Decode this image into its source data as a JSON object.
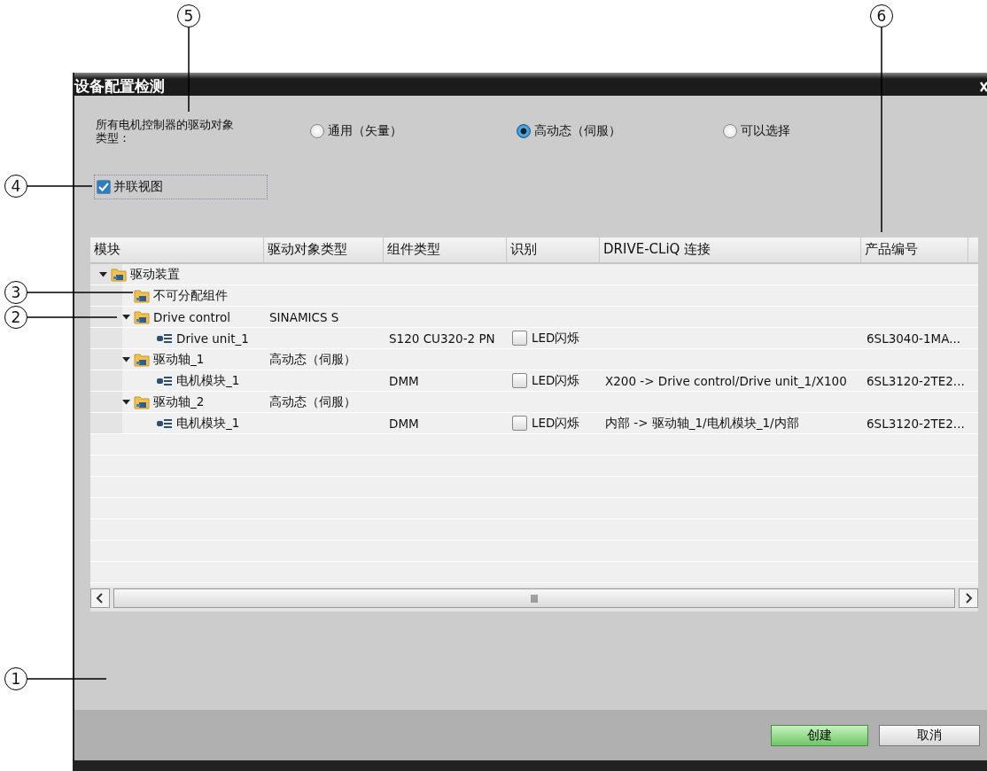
{
  "callouts": [
    {
      "number": "5"
    },
    {
      "number": "6"
    },
    {
      "number": "4"
    },
    {
      "number": "3"
    },
    {
      "number": "2"
    },
    {
      "number": "1"
    }
  ],
  "window": {
    "title": "设备配置检测"
  },
  "drive_type": {
    "label": "所有电机控制器的驱动对象类型：",
    "options": [
      {
        "label": "通用（矢量）",
        "selected": false
      },
      {
        "label": "高动态（伺服）",
        "selected": true
      },
      {
        "label": "可以选择",
        "selected": false
      }
    ]
  },
  "parallel_view": {
    "label": "并联视图",
    "checked": true
  },
  "table": {
    "columns": [
      "模块",
      "驱动对象类型",
      "组件类型",
      "识别",
      "DRIVE-CLiQ 连接",
      "产品编号"
    ],
    "rows": [
      {
        "kind": "folder",
        "name": "驱动装置",
        "expanded": true,
        "children": [
          {
            "kind": "folder",
            "name": "不可分配组件"
          },
          {
            "kind": "folder",
            "name": "Drive control",
            "expanded": true,
            "drive_type": "SINAMICS S",
            "children": [
              {
                "kind": "module",
                "name": "Drive unit_1",
                "component": "S120 CU320-2 PN",
                "identify": {
                  "label": "LED闪烁",
                  "checked": false
                },
                "order_number": "6SL3040-1MA..."
              }
            ]
          },
          {
            "kind": "folder",
            "name": "驱动轴_1",
            "expanded": true,
            "drive_type": "高动态（伺服）",
            "children": [
              {
                "kind": "module",
                "name": "电机模块_1",
                "component": "DMM",
                "identify": {
                  "label": "LED闪烁",
                  "checked": false
                },
                "connection": "X200 -> Drive control/Drive unit_1/X100",
                "order_number": "6SL3120-2TE2..."
              }
            ]
          },
          {
            "kind": "folder",
            "name": "驱动轴_2",
            "expanded": true,
            "drive_type": "高动态（伺服）",
            "children": [
              {
                "kind": "module",
                "name": "电机模块_1",
                "component": "DMM",
                "identify": {
                  "label": "LED闪烁",
                  "checked": false
                },
                "connection": "内部 -> 驱动轴_1/电机模块_1/内部",
                "order_number": "6SL3120-2TE2..."
              }
            ]
          }
        ]
      }
    ]
  },
  "buttons": [
    {
      "kind": "primary",
      "label": "创建"
    },
    {
      "kind": "normal",
      "label": "取消"
    }
  ]
}
